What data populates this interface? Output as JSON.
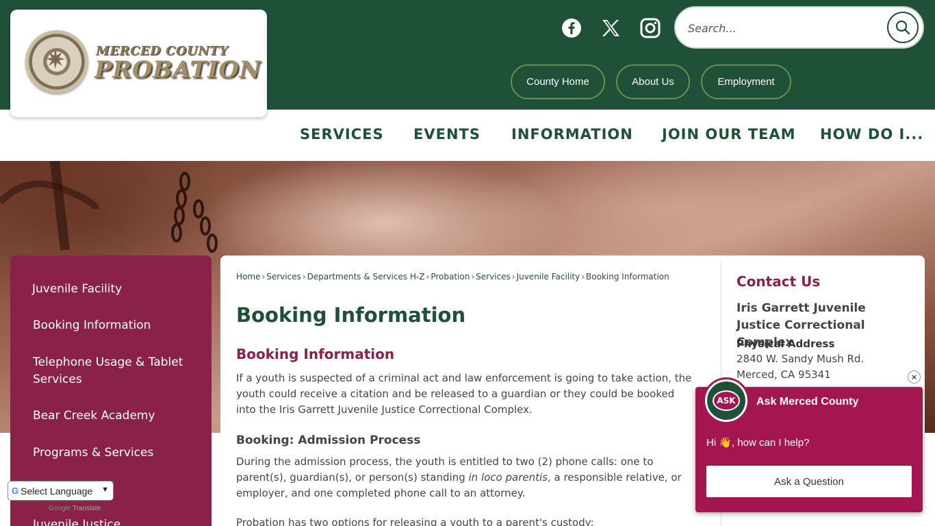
{
  "header": {
    "logo": {
      "line1": "MERCED COUNTY",
      "line2": "PROBATION"
    },
    "social": [
      "facebook-icon",
      "x-twitter-icon",
      "instagram-icon"
    ],
    "search": {
      "placeholder": "Search..."
    },
    "quick_links": [
      "County Home",
      "About Us",
      "Employment"
    ]
  },
  "nav": {
    "items": [
      "SERVICES",
      "EVENTS",
      "INFORMATION",
      "JOIN OUR TEAM",
      "HOW DO I..."
    ]
  },
  "sidebar": {
    "items": [
      "Juvenile Facility",
      "Booking Information",
      "Telephone Usage & Tablet Services",
      "Bear Creek Academy",
      "Programs & Services",
      "Juvenile Justice"
    ]
  },
  "breadcrumb": {
    "items": [
      "Home",
      "Services",
      "Departments & Services H-Z",
      "Probation",
      "Services",
      "Juvenile Facility"
    ],
    "current": "Booking Information",
    "separator": "›"
  },
  "content": {
    "title": "Booking Information",
    "subtitle": "Booking Information",
    "para1": "If a youth is suspected of a criminal act and law enforcement is going to take action, the youth could receive a citation and be released to a guardian or they could be booked into the Iris Garrett Juvenile Justice Correctional Complex.",
    "heading2": "Booking: Admission Process",
    "para2_a": "During the admission process, the youth is entitled to two (2) phone calls: one to parent(s), guardian(s), or person(s) standing ",
    "para2_italic": "in loco parentis",
    "para2_b": ", a responsible relative, or employer, and one completed phone call to an attorney.",
    "para3": "Probation has two options for releasing a youth to a parent's custody:"
  },
  "contact": {
    "title": "Contact Us",
    "org": "Iris Garrett Juvenile Justice Correctional Complex",
    "label": "Physical Address",
    "address1": "2840 W. Sandy Mush Rd.",
    "address2": "Merced, CA 95341"
  },
  "chat": {
    "avatar_text": "ASK",
    "name": "Ask Merced County",
    "greeting": "Hi 👋, how can I help?",
    "button": "Ask a Question",
    "close": "×"
  },
  "translate": {
    "selected": "Select Language",
    "powered_by": "Google",
    "service": "Translate"
  },
  "colors": {
    "green": "#1e5138",
    "maroon": "#8a2149",
    "chat": "#a3164f"
  }
}
